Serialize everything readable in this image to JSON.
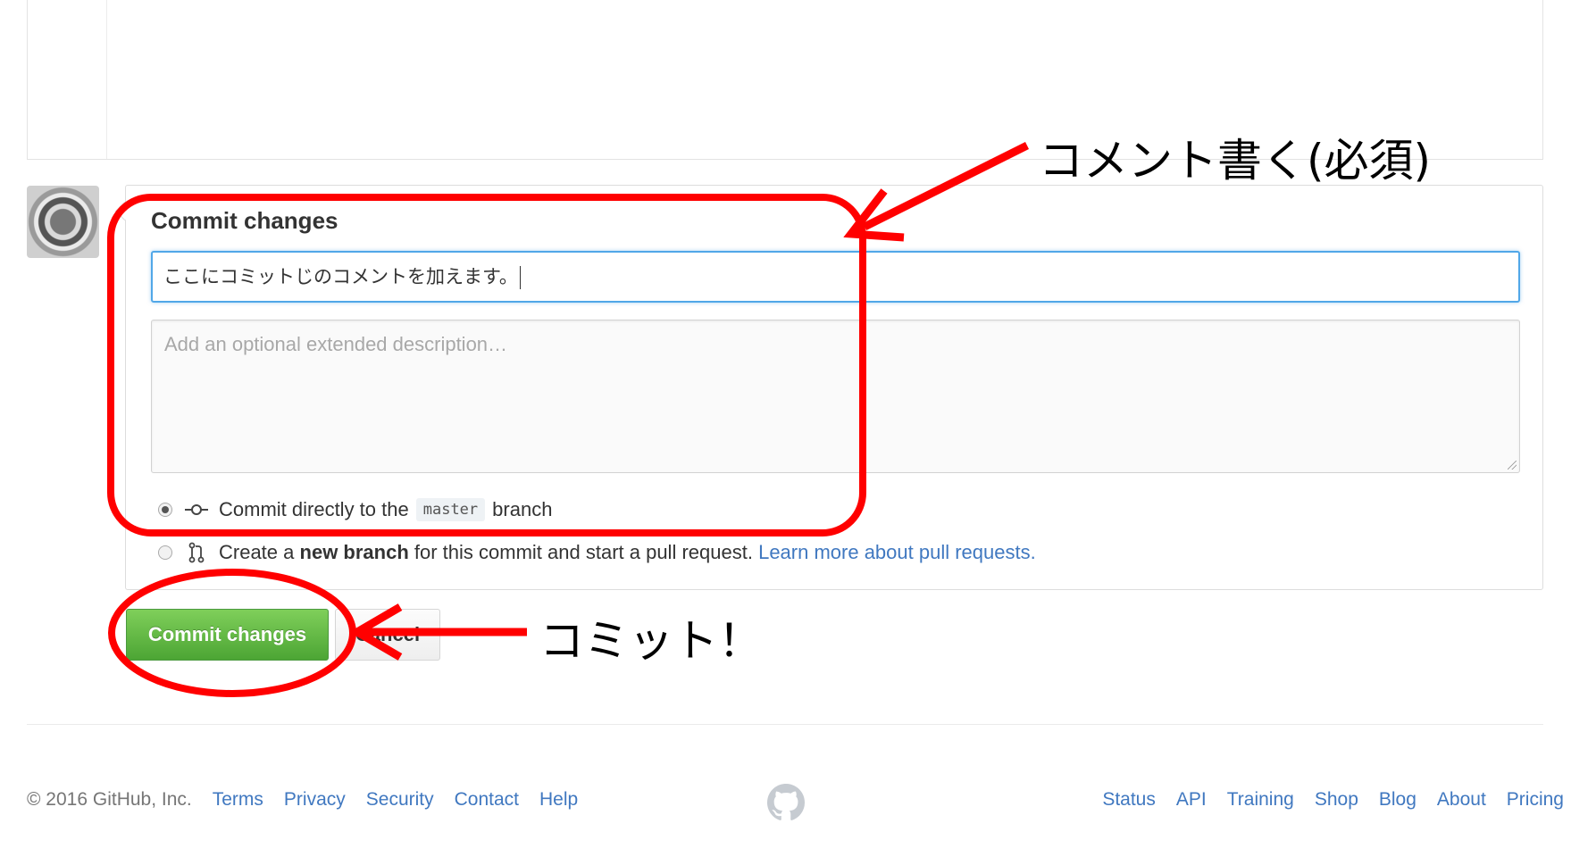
{
  "commit": {
    "title": "Commit changes",
    "message_value": "ここにコミットじのコメントを加えます。",
    "description_placeholder": "Add an optional extended description…",
    "option_direct_prefix": "Commit directly to the",
    "branch_name": "master",
    "option_direct_suffix": "branch",
    "option_new_prefix": "Create a",
    "option_new_bold": "new branch",
    "option_new_suffix": "for this commit and start a pull request.",
    "option_new_link": "Learn more about pull requests.",
    "commit_button": "Commit changes",
    "cancel_button": "Cancel"
  },
  "annotations": {
    "comment_note": "コメント書く(必須)",
    "commit_note": "コミット！"
  },
  "footer": {
    "copyright": "© 2016 GitHub, Inc.",
    "left_links": [
      "Terms",
      "Privacy",
      "Security",
      "Contact",
      "Help"
    ],
    "right_links": [
      "Status",
      "API",
      "Training",
      "Shop",
      "Blog",
      "About",
      "Pricing"
    ]
  },
  "colors": {
    "link": "#4078c0",
    "primary_button": "#55a532",
    "focus_border": "#51a7e8",
    "annotation_red": "#ff0000"
  },
  "icons": [
    "git-commit-icon",
    "git-pull-request-icon",
    "github-mark-icon",
    "avatar-bearing-image"
  ]
}
